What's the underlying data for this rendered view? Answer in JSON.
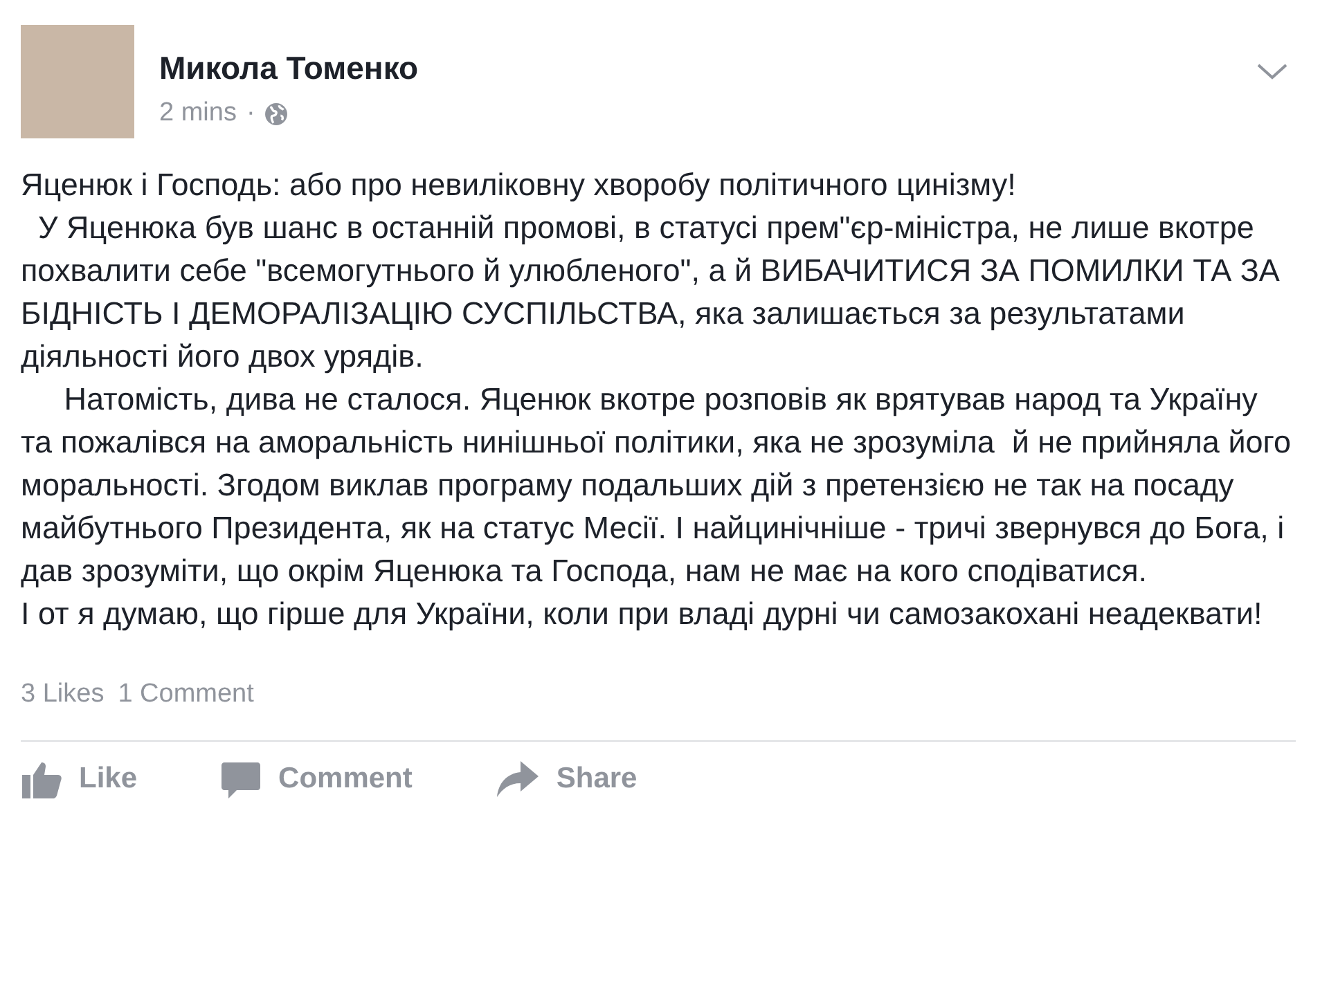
{
  "post": {
    "author": "Микола Томенко",
    "time": "2 mins",
    "separator": "·",
    "paragraphs": [
      "Яценюк і Господь: або про невиліковну хворобу політичного цинізму!",
      "  У Яценюка був шанс в останній промові, в статусі прем\"єр-міністра, не лише вкотре похвалити себе \"всемогутнього й улюбленого\", а й ВИБАЧИТИСЯ ЗА ПОМИЛКИ ТА ЗА БІДНІСТЬ І ДЕМОРАЛІЗАЦІЮ СУСПІЛЬСТВА, яка залишається за результатами діяльності його двох урядів.",
      "     Натомість, дива не сталося. Яценюк вкотре розповів як врятував народ та Україну та пожалівся на аморальність нинішньої політики, яка не зрозуміла  й не прийняла його моральності. Згодом виклав програму подальших дій з претензією не так на посаду майбутнього Президента, як на статус Месії. І найцинічніше - тричі звернувся до Бога, і дав зрозуміти, що окрім Яценюка та Господа, нам не має на кого сподіватися.",
      "І от я думаю, що гірше для України, коли при владі дурні чи самозакохані неадеквати!"
    ],
    "likes": "3 Likes",
    "comments": "1 Comment"
  },
  "actions": [
    {
      "kind": "like",
      "label": "Like"
    },
    {
      "kind": "comment",
      "label": "Comment"
    },
    {
      "kind": "share",
      "label": "Share"
    }
  ]
}
